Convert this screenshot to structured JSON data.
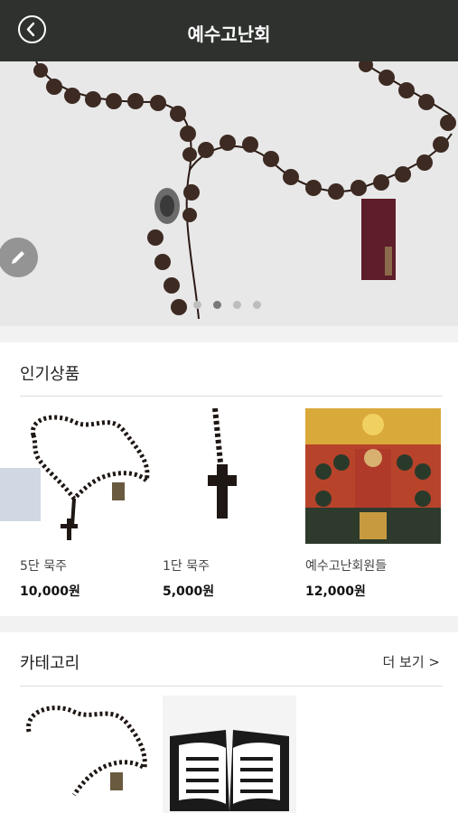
{
  "header": {
    "title": "예수고난회",
    "back_icon": "chevron-left-icon"
  },
  "hero": {
    "slide_count": 4,
    "active_slide": 2,
    "edit_icon": "pencil-icon"
  },
  "popular": {
    "title": "인기상품",
    "products": [
      {
        "name": "5단 묵주",
        "price": "10,000원"
      },
      {
        "name": "1단 묵주",
        "price": "5,000원"
      },
      {
        "name": "예수고난회원들",
        "price": "12,000원"
      }
    ]
  },
  "category": {
    "title": "카테고리",
    "more_label": "더 보기 >",
    "book_icon": "open-book-icon"
  },
  "colors": {
    "header_bg": "#2e312e",
    "bead": "#3d2a22",
    "tag": "#5e1d2a"
  }
}
